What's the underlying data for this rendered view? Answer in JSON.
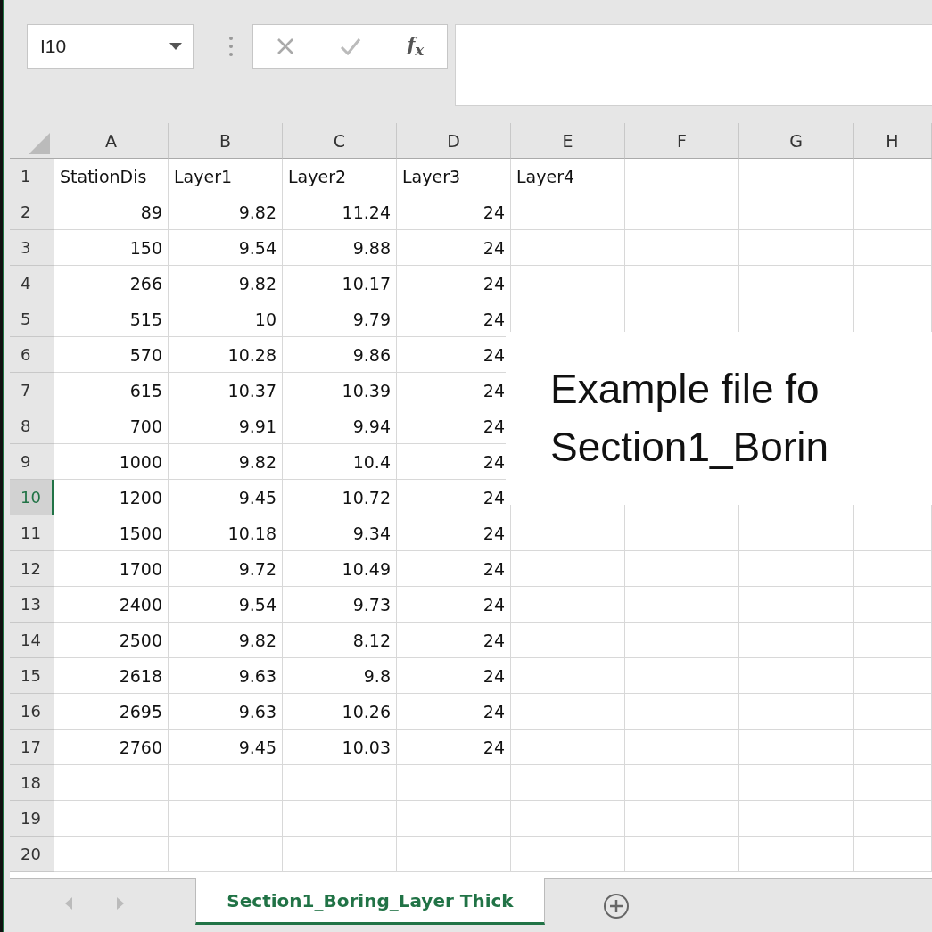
{
  "name_box": {
    "value": "I10"
  },
  "formula_bar": {
    "fx": "f$_{x}$"
  },
  "columns": [
    {
      "label": "A",
      "selected": false
    },
    {
      "label": "B",
      "selected": false
    },
    {
      "label": "C",
      "selected": false
    },
    {
      "label": "D",
      "selected": false
    },
    {
      "label": "E",
      "selected": false
    },
    {
      "label": "F",
      "selected": false
    },
    {
      "label": "G",
      "selected": false
    },
    {
      "label": "H",
      "selected": false
    }
  ],
  "rows": [
    {
      "number": "1",
      "selected": false,
      "cells": [
        {
          "text": "StationDis",
          "kind": "text"
        },
        {
          "text": "Layer1",
          "kind": "text"
        },
        {
          "text": "Layer2",
          "kind": "text"
        },
        {
          "text": "Layer3",
          "kind": "text"
        },
        {
          "text": "Layer4",
          "kind": "text"
        }
      ]
    },
    {
      "number": "2",
      "selected": false,
      "cells": [
        {
          "text": "89",
          "kind": "number"
        },
        {
          "text": "9.82",
          "kind": "number"
        },
        {
          "text": "11.24",
          "kind": "number"
        },
        {
          "text": "24",
          "kind": "number"
        }
      ]
    },
    {
      "number": "3",
      "selected": false,
      "cells": [
        {
          "text": "150",
          "kind": "number"
        },
        {
          "text": "9.54",
          "kind": "number"
        },
        {
          "text": "9.88",
          "kind": "number"
        },
        {
          "text": "24",
          "kind": "number"
        }
      ]
    },
    {
      "number": "4",
      "selected": false,
      "cells": [
        {
          "text": "266",
          "kind": "number"
        },
        {
          "text": "9.82",
          "kind": "number"
        },
        {
          "text": "10.17",
          "kind": "number"
        },
        {
          "text": "24",
          "kind": "number"
        }
      ]
    },
    {
      "number": "5",
      "selected": false,
      "cells": [
        {
          "text": "515",
          "kind": "number"
        },
        {
          "text": "10",
          "kind": "number"
        },
        {
          "text": "9.79",
          "kind": "number"
        },
        {
          "text": "24",
          "kind": "number"
        }
      ]
    },
    {
      "number": "6",
      "selected": false,
      "cells": [
        {
          "text": "570",
          "kind": "number"
        },
        {
          "text": "10.28",
          "kind": "number"
        },
        {
          "text": "9.86",
          "kind": "number"
        },
        {
          "text": "24",
          "kind": "number"
        }
      ]
    },
    {
      "number": "7",
      "selected": false,
      "cells": [
        {
          "text": "615",
          "kind": "number"
        },
        {
          "text": "10.37",
          "kind": "number"
        },
        {
          "text": "10.39",
          "kind": "number"
        },
        {
          "text": "24",
          "kind": "number"
        }
      ]
    },
    {
      "number": "8",
      "selected": false,
      "cells": [
        {
          "text": "700",
          "kind": "number"
        },
        {
          "text": "9.91",
          "kind": "number"
        },
        {
          "text": "9.94",
          "kind": "number"
        },
        {
          "text": "24",
          "kind": "number"
        }
      ]
    },
    {
      "number": "9",
      "selected": false,
      "cells": [
        {
          "text": "1000",
          "kind": "number"
        },
        {
          "text": "9.82",
          "kind": "number"
        },
        {
          "text": "10.4",
          "kind": "number"
        },
        {
          "text": "24",
          "kind": "number"
        }
      ]
    },
    {
      "number": "10",
      "selected": true,
      "cells": [
        {
          "text": "1200",
          "kind": "number"
        },
        {
          "text": "9.45",
          "kind": "number"
        },
        {
          "text": "10.72",
          "kind": "number"
        },
        {
          "text": "24",
          "kind": "number"
        }
      ]
    },
    {
      "number": "11",
      "selected": false,
      "cells": [
        {
          "text": "1500",
          "kind": "number"
        },
        {
          "text": "10.18",
          "kind": "number"
        },
        {
          "text": "9.34",
          "kind": "number"
        },
        {
          "text": "24",
          "kind": "number"
        }
      ]
    },
    {
      "number": "12",
      "selected": false,
      "cells": [
        {
          "text": "1700",
          "kind": "number"
        },
        {
          "text": "9.72",
          "kind": "number"
        },
        {
          "text": "10.49",
          "kind": "number"
        },
        {
          "text": "24",
          "kind": "number"
        }
      ]
    },
    {
      "number": "13",
      "selected": false,
      "cells": [
        {
          "text": "2400",
          "kind": "number"
        },
        {
          "text": "9.54",
          "kind": "number"
        },
        {
          "text": "9.73",
          "kind": "number"
        },
        {
          "text": "24",
          "kind": "number"
        }
      ]
    },
    {
      "number": "14",
      "selected": false,
      "cells": [
        {
          "text": "2500",
          "kind": "number"
        },
        {
          "text": "9.82",
          "kind": "number"
        },
        {
          "text": "8.12",
          "kind": "number"
        },
        {
          "text": "24",
          "kind": "number"
        }
      ]
    },
    {
      "number": "15",
      "selected": false,
      "cells": [
        {
          "text": "2618",
          "kind": "number"
        },
        {
          "text": "9.63",
          "kind": "number"
        },
        {
          "text": "9.8",
          "kind": "number"
        },
        {
          "text": "24",
          "kind": "number"
        }
      ]
    },
    {
      "number": "16",
      "selected": false,
      "cells": [
        {
          "text": "2695",
          "kind": "number"
        },
        {
          "text": "9.63",
          "kind": "number"
        },
        {
          "text": "10.26",
          "kind": "number"
        },
        {
          "text": "24",
          "kind": "number"
        }
      ]
    },
    {
      "number": "17",
      "selected": false,
      "cells": [
        {
          "text": "2760",
          "kind": "number"
        },
        {
          "text": "9.45",
          "kind": "number"
        },
        {
          "text": "10.03",
          "kind": "number"
        },
        {
          "text": "24",
          "kind": "number"
        }
      ]
    },
    {
      "number": "18",
      "selected": false,
      "cells": []
    },
    {
      "number": "19",
      "selected": false,
      "cells": []
    },
    {
      "number": "20",
      "selected": false,
      "cells": []
    }
  ],
  "overlay_note": {
    "lines": [
      "Example file fo",
      "Section1_Borin"
    ]
  },
  "sheet_tabs": [
    {
      "label": "Section1_Boring_Layer Thick",
      "selected": true
    }
  ]
}
